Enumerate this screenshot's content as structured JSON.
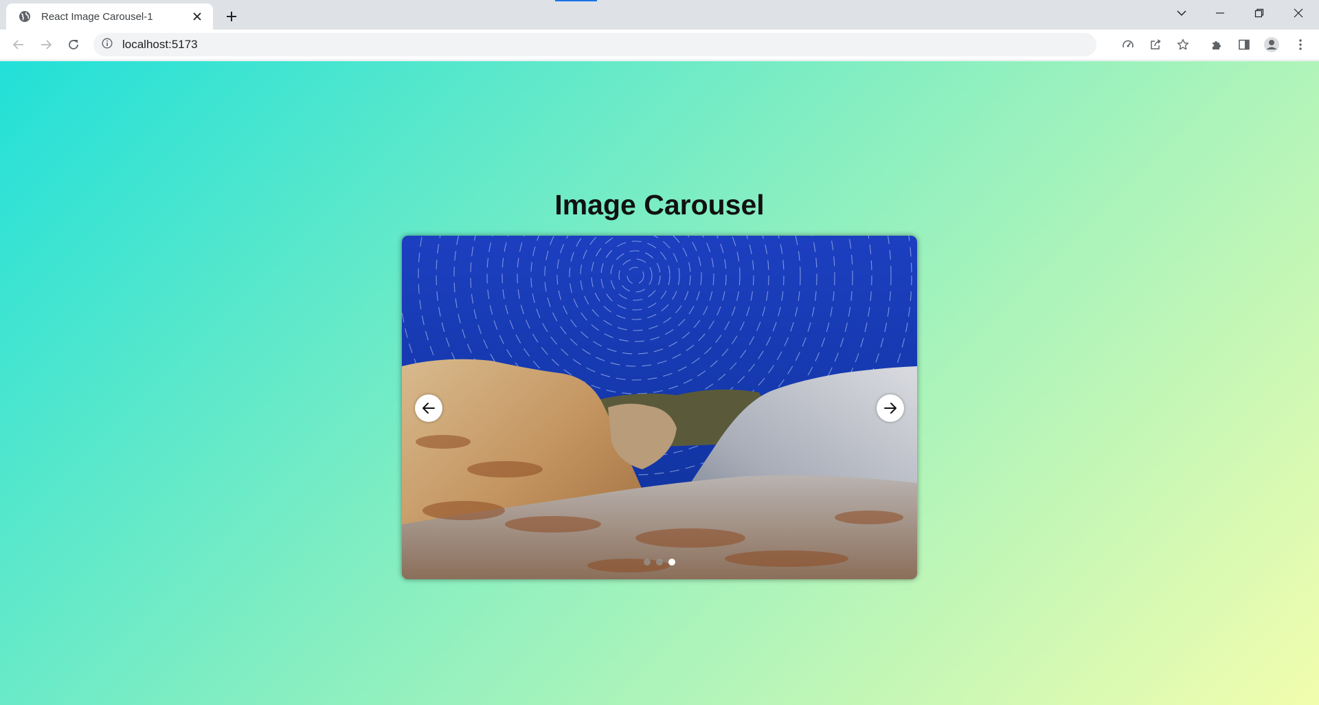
{
  "browser": {
    "tab_title": "React Image Carousel-1",
    "url": "localhost:5173"
  },
  "page": {
    "heading": "Image Carousel"
  },
  "carousel": {
    "slide_count": 3,
    "active_index": 2,
    "image_description": "star trails over rocks"
  },
  "colors": {
    "gradient_start": "#22e0d8",
    "gradient_mid": "#8aefc0",
    "gradient_end": "#f2fdae",
    "tabstrip_bg": "#dee1e6"
  }
}
